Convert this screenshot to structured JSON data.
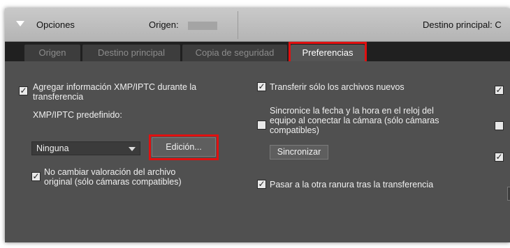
{
  "header": {
    "title": "Opciones",
    "origin_label": "Origen:",
    "destination_label": "Destino principal: C"
  },
  "tabs": [
    {
      "label": "Origen",
      "active": false
    },
    {
      "label": "Destino principal",
      "active": false
    },
    {
      "label": "Copia de seguridad",
      "active": false
    },
    {
      "label": "Preferencias",
      "active": true
    }
  ],
  "preferences": {
    "add_xmp": {
      "checked": true,
      "label_line1": "Agregar información XMP/IPTC durante la",
      "label_line2": "transferencia"
    },
    "default_xmp_label": "XMP/IPTC predefinido:",
    "default_xmp_value": "Ninguna",
    "edit_button": "Edición...",
    "no_change_rating": {
      "checked": true,
      "label_line1": "No cambiar valoración del archivo",
      "label_line2": "original (sólo cámaras compatibles)"
    },
    "new_files_only": {
      "checked": true,
      "label": "Transferir sólo los archivos nuevos"
    },
    "sync_time": {
      "checked": false,
      "label_line1": "Sincronice la fecha y la hora en el reloj del",
      "label_line2": "equipo al conectar la cámara (sólo cámaras",
      "label_line3": "compatibles)"
    },
    "sync_button": "Sincronizar",
    "next_slot": {
      "checked": true,
      "label": "Pasar a la otra ranura tras la transferencia"
    }
  },
  "right_column_checkboxes": [
    true,
    false,
    true
  ],
  "colors": {
    "highlight": "#e11010",
    "panel": "#505050",
    "header": "#c0c0c0"
  }
}
